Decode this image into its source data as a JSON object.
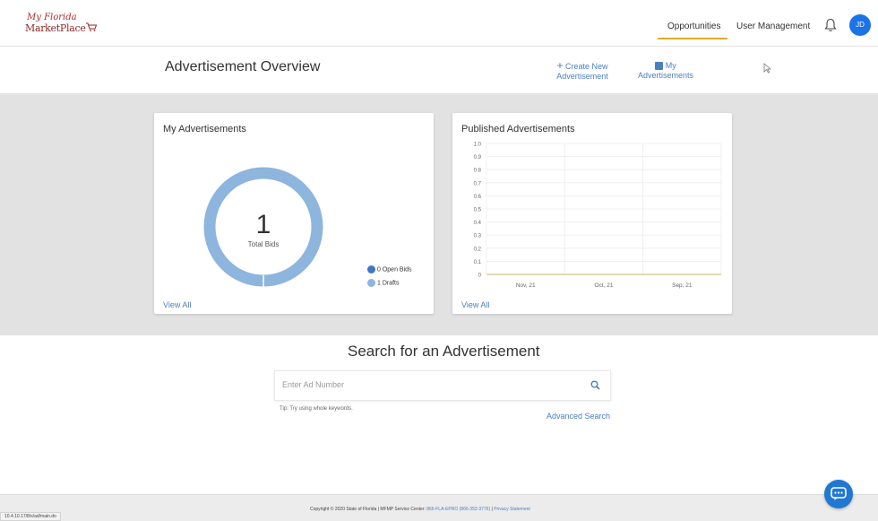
{
  "header": {
    "logo_script": "My Florida",
    "logo_name": "MarketPlace",
    "nav": {
      "opportunities": "Opportunities",
      "user_management": "User Management"
    },
    "avatar_initials": "JD"
  },
  "overview": {
    "title": "Advertisement Overview",
    "create_new": "Create New",
    "create_new_2": "Advertisement",
    "my_ads": "My",
    "my_ads_2": "Advertisements"
  },
  "my_ads_card": {
    "title": "My Advertisements",
    "total": "1",
    "total_label": "Total Bids",
    "legend": [
      {
        "label": "0 Open Bids",
        "color": "#3d78c6"
      },
      {
        "label": "1 Drafts",
        "color": "#8db5de"
      }
    ],
    "view_all": "View All"
  },
  "published_card": {
    "title": "Published Advertisements",
    "view_all": "View All"
  },
  "chart_data": {
    "type": "line",
    "title": "Published Advertisements",
    "categories": [
      "Nov, 21",
      "Oct, 21",
      "Sep, 21"
    ],
    "values": [
      0,
      0,
      0
    ],
    "ylim": [
      0,
      1.0
    ],
    "yticks": [
      "1.0",
      "0.9",
      "0.8",
      "0.7",
      "0.6",
      "0.5",
      "0.4",
      "0.3",
      "0.2",
      "0.1",
      "0"
    ],
    "grid": true
  },
  "search": {
    "title": "Search for an Advertisement",
    "placeholder": "Enter Ad Number",
    "tip": "Tip: Try using whole keywords.",
    "advanced": "Advanced Search"
  },
  "footer": {
    "copyright": "Copyright © 2020 State of Florida  |  MFMP Service Center:",
    "phone": "866-FLA-EPRO (866-352-3776)",
    "privacy": "Privacy Statement"
  },
  "status_bar_url": "10.4.10.17/8/s/ad/main.do",
  "colors": {
    "accent": "#e2ac2b",
    "link": "#4a7fc0",
    "donut": "#8db5de",
    "chart_line": "#d6cf9a"
  }
}
